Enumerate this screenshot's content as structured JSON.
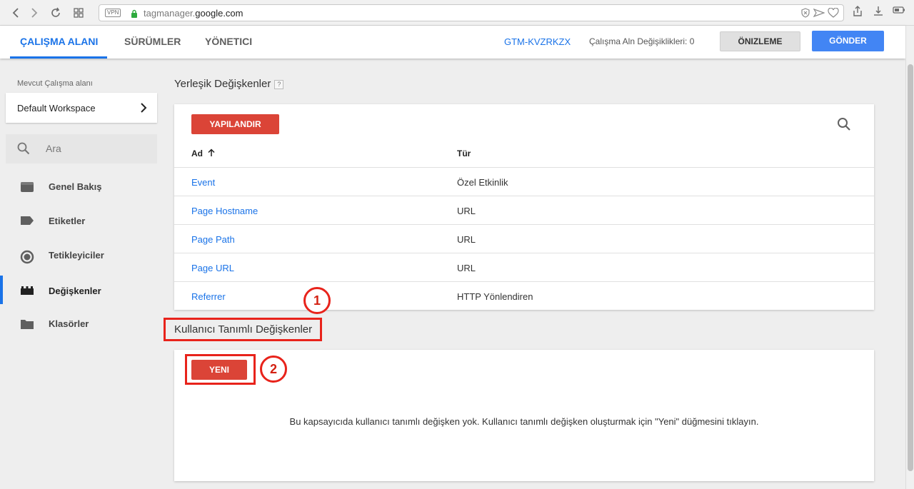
{
  "browser": {
    "vpn_badge": "VPN",
    "url_prefix": "tagmanager.",
    "url_domain": "google.com"
  },
  "header": {
    "tabs": [
      {
        "label": "ÇALIŞMA ALANI",
        "active": true
      },
      {
        "label": "SÜRÜMLER",
        "active": false
      },
      {
        "label": "YÖNETICI",
        "active": false
      }
    ],
    "container_id": "GTM-KVZRKZX",
    "workspace_changes": "Çalışma Aln Değişiklikleri: 0",
    "preview_label": "ÖNIZLEME",
    "submit_label": "GÖNDER",
    "accent_color": "#1a73e8"
  },
  "sidebar": {
    "workspace_label": "Mevcut Çalışma alanı",
    "workspace_name": "Default Workspace",
    "search_placeholder": "Ara",
    "items": [
      {
        "label": "Genel Bakış",
        "icon": "overview-icon",
        "active": false
      },
      {
        "label": "Etiketler",
        "icon": "tag-icon",
        "active": false
      },
      {
        "label": "Tetikleyiciler",
        "icon": "trigger-icon",
        "active": false
      },
      {
        "label": "Değişkenler",
        "icon": "variables-icon",
        "active": true
      },
      {
        "label": "Klasörler",
        "icon": "folder-icon",
        "active": false
      }
    ]
  },
  "builtin": {
    "title": "Yerleşik Değişkenler",
    "help": "?",
    "configure_label": "YAPILANDIR",
    "col_name": "Ad",
    "col_type": "Tür",
    "rows": [
      {
        "name": "Event",
        "type": "Özel Etkinlik"
      },
      {
        "name": "Page Hostname",
        "type": "URL"
      },
      {
        "name": "Page Path",
        "type": "URL"
      },
      {
        "name": "Page URL",
        "type": "URL"
      },
      {
        "name": "Referrer",
        "type": "HTTP Yönlendiren"
      }
    ]
  },
  "user_defined": {
    "title": "Kullanıcı Tanımlı Değişkenler",
    "new_label": "YENI",
    "empty_message": "Bu kapsayıcıda kullanıcı tanımlı değişken yok. Kullanıcı tanımlı değişken oluşturmak için \"Yeni\" düğmesini tıklayın."
  },
  "annotations": {
    "step1": "1",
    "step2": "2",
    "color": "#e8231b"
  }
}
